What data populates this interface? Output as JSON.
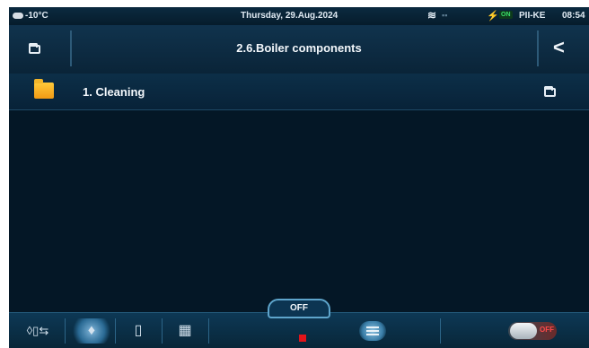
{
  "status": {
    "weather_icon": "cloud-icon",
    "outdoor_temp": "-10°C",
    "date": "Thursday, 29.Aug.2024",
    "wifi_icon": "wifi-icon",
    "connection_badge": "ON",
    "device_id": "PII-KE",
    "time": "08:54"
  },
  "header": {
    "title": "2.6.Boiler components",
    "left_icon": "folder-icon",
    "back_icon": "chevron-left-icon",
    "back_glyph": "<"
  },
  "list": {
    "items": [
      {
        "label": "1.  Cleaning",
        "icon": "folder-icon",
        "right_icon": "folder-outline-icon"
      }
    ]
  },
  "bottom": {
    "tabs": [
      {
        "glyph": "◊▯⇆",
        "icon": "system-schematic-icon"
      },
      {
        "glyph": "♦",
        "icon": "flame-icon"
      },
      {
        "glyph": "▯",
        "icon": "boiler-icon"
      },
      {
        "glyph": "▦",
        "icon": "radiator-icon"
      }
    ],
    "status_label": "OFF",
    "menu_icon": "menu-icon",
    "power_toggle_label": "OFF",
    "colors": {
      "status_indicator": "#e3141a",
      "accent": "#5ea5cc"
    }
  }
}
